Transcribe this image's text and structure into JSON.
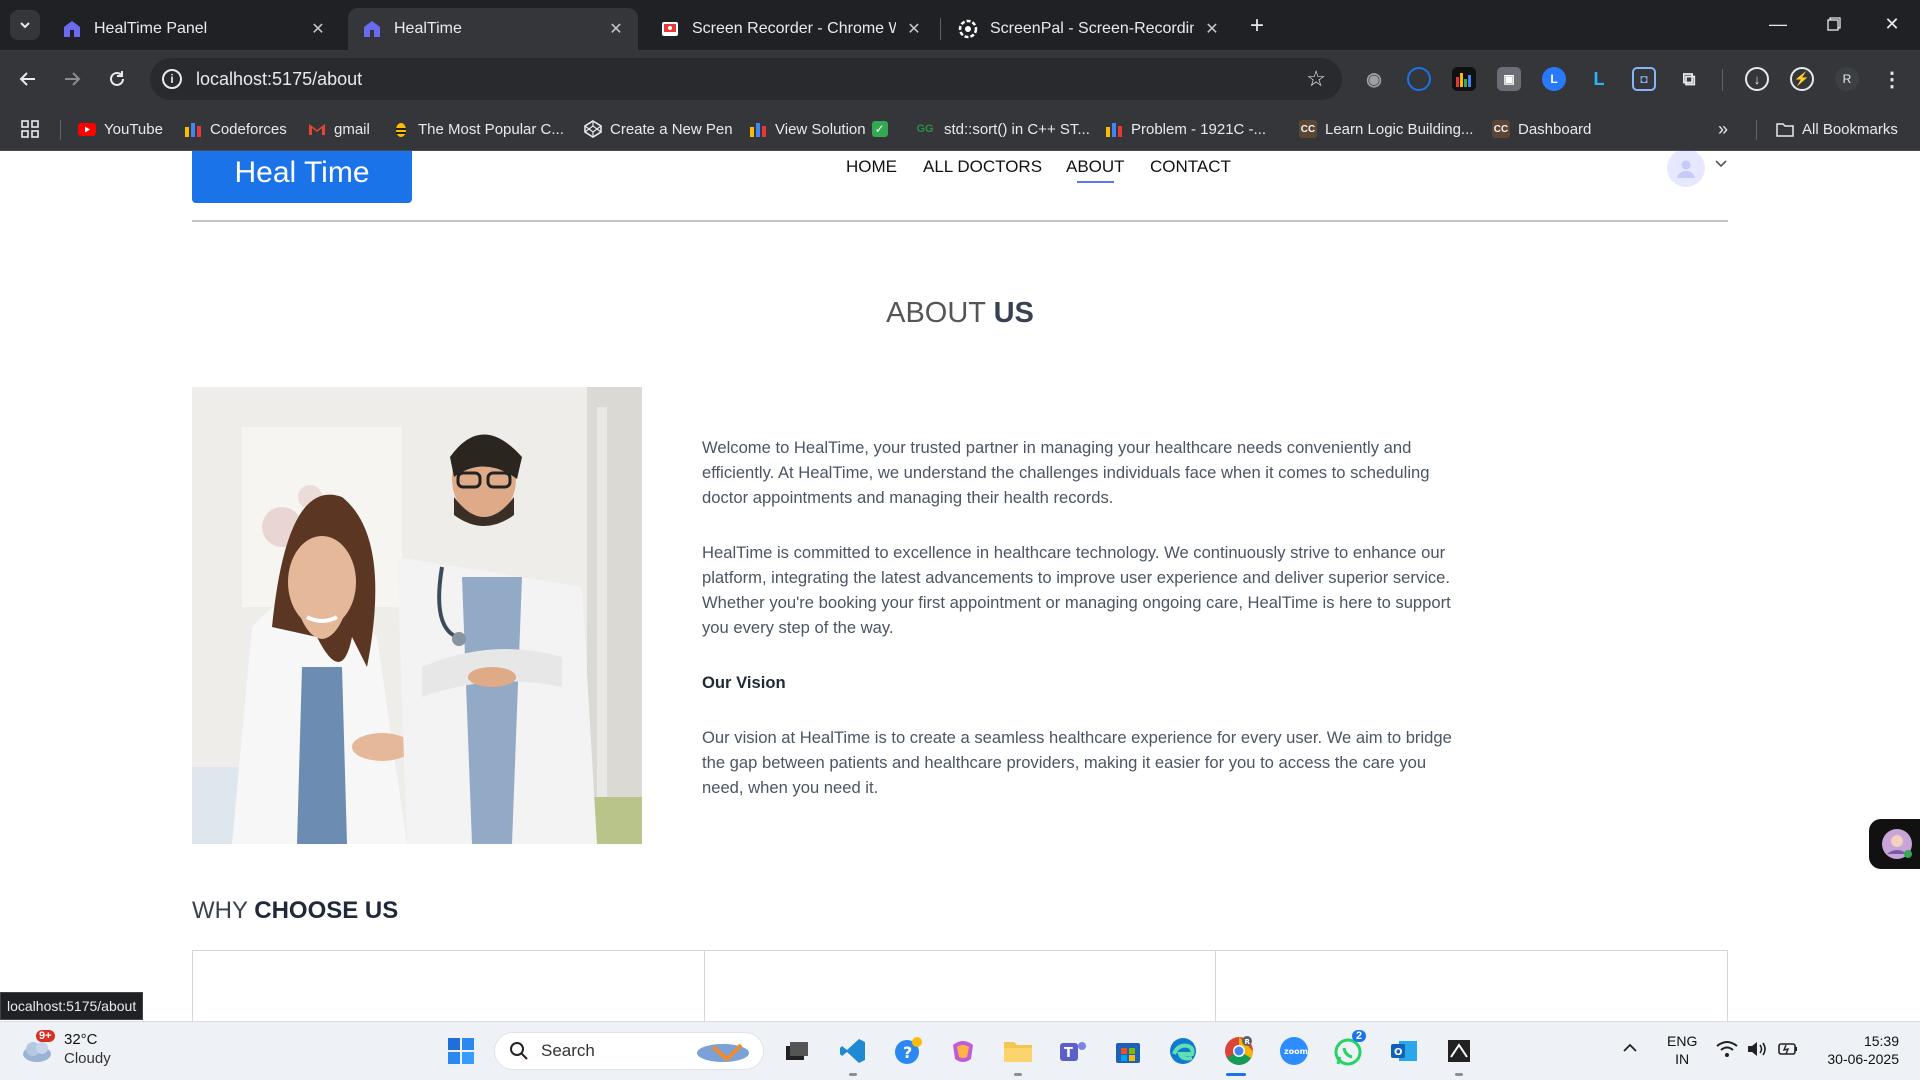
{
  "browser": {
    "tabs": [
      {
        "title": "HealTime Panel",
        "active": false
      },
      {
        "title": "HealTime",
        "active": true
      },
      {
        "title": "Screen Recorder - Chrome Web",
        "active": false
      },
      {
        "title": "ScreenPal - Screen-Recording",
        "active": false
      }
    ],
    "url": "localhost:5175/about",
    "profile_initial": "R",
    "bookmarks": [
      {
        "label": "YouTube",
        "icon": "youtube-icon"
      },
      {
        "label": "Codeforces",
        "icon": "codeforces-icon"
      },
      {
        "label": "gmail",
        "icon": "gmail-icon"
      },
      {
        "label": "The Most Popular C...",
        "icon": "bee-icon"
      },
      {
        "label": "Create a New Pen",
        "icon": "codepen-icon"
      },
      {
        "label": "View Solution",
        "icon": "codeforces-icon"
      },
      {
        "label": "std::sort() in C++ ST...",
        "icon": "gfg-icon"
      },
      {
        "label": "Problem - 1921C -...",
        "icon": "codeforces-icon"
      },
      {
        "label": "Learn Logic Building...",
        "icon": "cc-icon"
      },
      {
        "label": "Dashboard",
        "icon": "cc-icon"
      }
    ],
    "all_bookmarks": "All Bookmarks",
    "status_url": "localhost:5175/about"
  },
  "site": {
    "logo": "Heal Time",
    "nav": [
      "HOME",
      "ALL DOCTORS",
      "ABOUT",
      "CONTACT"
    ],
    "active_nav": "ABOUT",
    "about_title_light": "ABOUT",
    "about_title_bold": "US",
    "paragraph1": "Welcome to HealTime, your trusted partner in managing your healthcare needs conveniently and efficiently. At HealTime, we understand the challenges individuals face when it comes to scheduling doctor appointments and managing their health records.",
    "paragraph2": "HealTime is committed to excellence in healthcare technology. We continuously strive to enhance our platform, integrating the latest advancements to improve user experience and deliver superior service. Whether you're booking your first appointment or managing ongoing care, HealTime is here to support you every step of the way.",
    "vision_heading": "Our Vision",
    "paragraph3": "Our vision at HealTime is to create a seamless healthcare experience for every user. We aim to bridge the gap between patients and healthcare providers, making it easier for you to access the care you need, when you need it.",
    "why_light": "WHY",
    "why_bold": "CHOOSE US"
  },
  "taskbar": {
    "weather_badge": "9+",
    "temperature": "32°C",
    "condition": "Cloudy",
    "search_placeholder": "Search",
    "language": "ENG",
    "region": "IN",
    "time": "15:39",
    "date": "30-06-2025",
    "whatsapp_badge": "2"
  },
  "colors": {
    "accent": "#5f6fff",
    "logo_bg": "#1a73e8",
    "chrome_dark": "#202124"
  }
}
